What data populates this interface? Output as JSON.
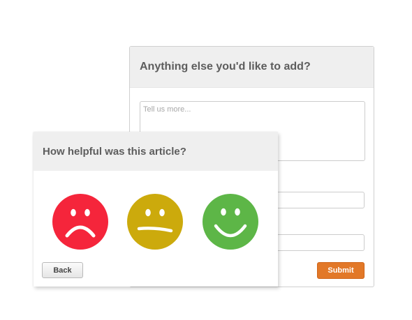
{
  "feedback_form": {
    "title": "Anything else you'd like to add?",
    "comment_placeholder": "Tell us more...",
    "submit_label": "Submit",
    "submit_color": "#e27828"
  },
  "rating": {
    "title": "How helpful was this article?",
    "faces": [
      {
        "icon": "sad-face-icon",
        "color": "#f5253b"
      },
      {
        "icon": "neutral-face-icon",
        "color": "#ccaa0c"
      },
      {
        "icon": "happy-face-icon",
        "color": "#5db647"
      }
    ],
    "back_label": "Back"
  }
}
